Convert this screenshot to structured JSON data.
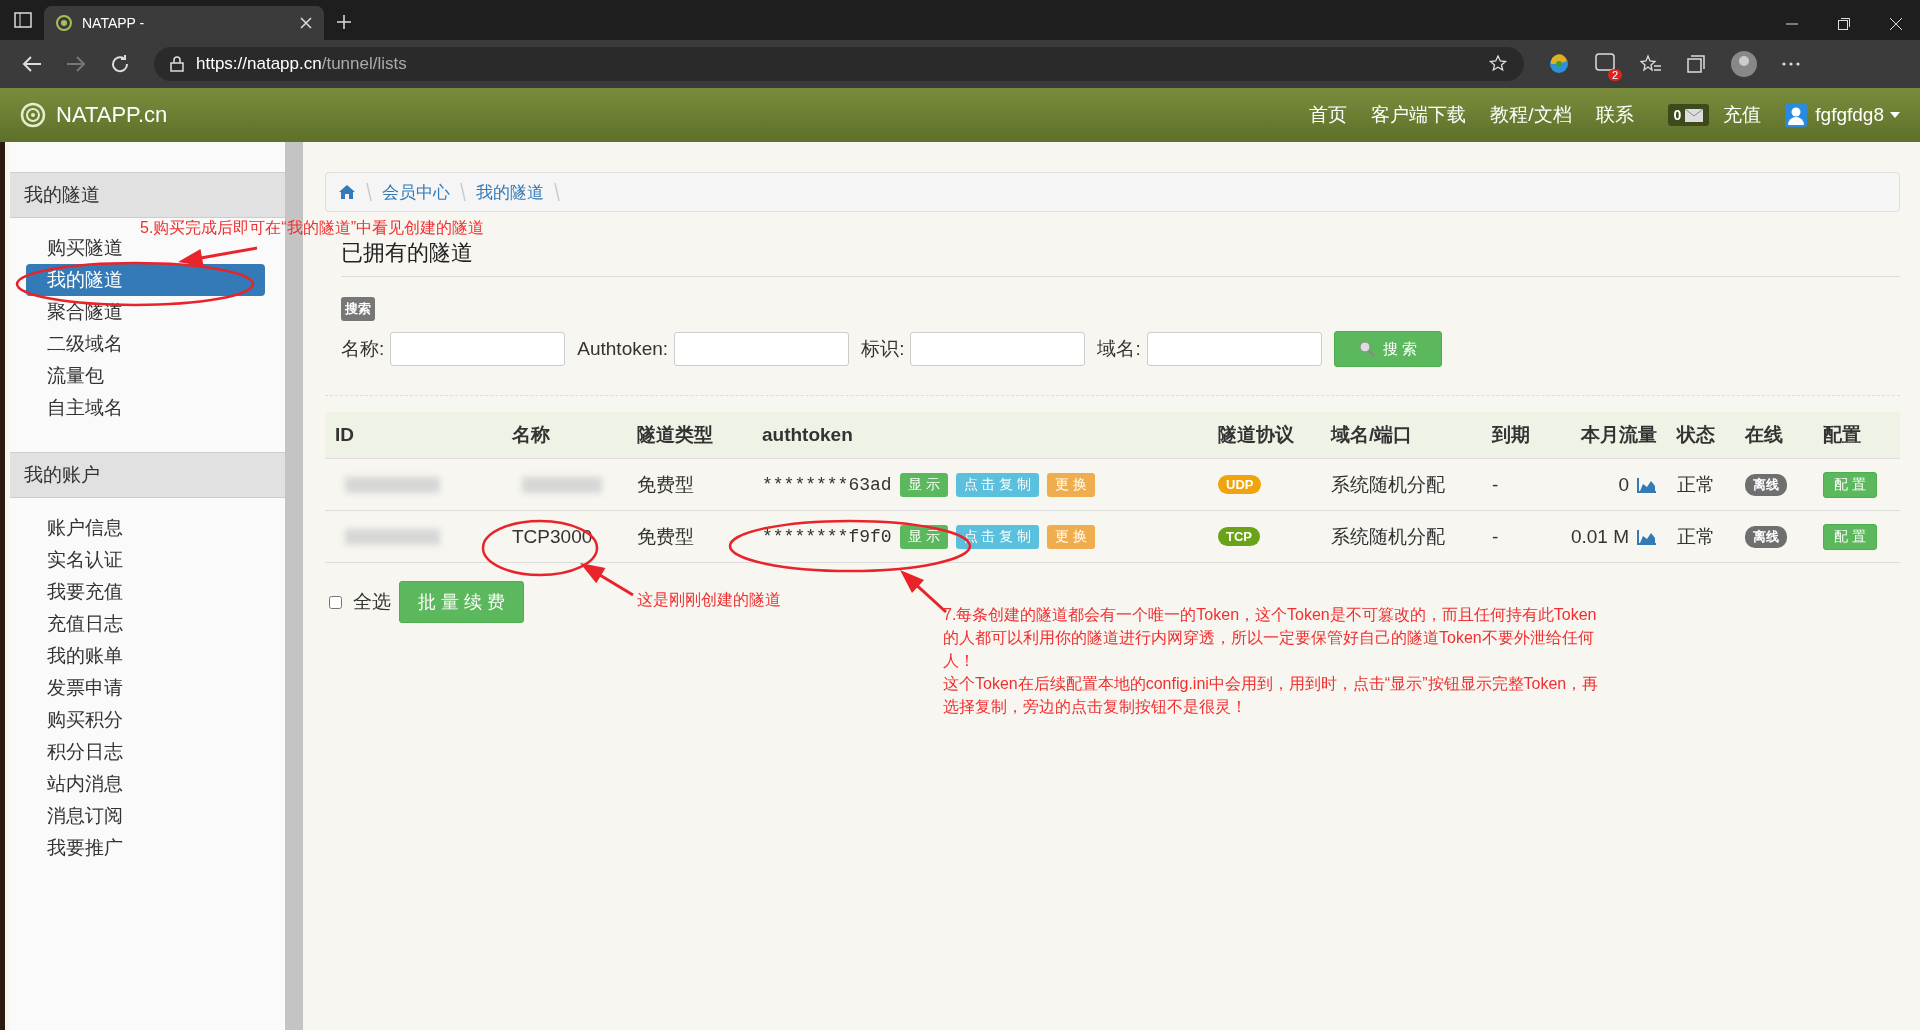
{
  "browser": {
    "tab_title": "NATAPP -",
    "url_host": "https://natapp.cn",
    "url_path": "/tunnel/lists",
    "extension_badge": "2"
  },
  "navbar": {
    "logo": "NATAPP.cn",
    "links": [
      "首页",
      "客户端下载",
      "教程/文档",
      "联系"
    ],
    "mail_count": "0",
    "recharge": "充值",
    "user": "fgfgfdg8"
  },
  "sidebar": [
    {
      "title": "我的隧道",
      "items": [
        {
          "label": "购买隧道",
          "selected": false
        },
        {
          "label": "我的隧道",
          "selected": true
        },
        {
          "label": "聚合隧道",
          "selected": false
        },
        {
          "label": "二级域名",
          "selected": false
        },
        {
          "label": "流量包",
          "selected": false
        },
        {
          "label": "自主域名",
          "selected": false
        }
      ]
    },
    {
      "title": "我的账户",
      "items": [
        {
          "label": "账户信息",
          "selected": false
        },
        {
          "label": "实名认证",
          "selected": false
        },
        {
          "label": "我要充值",
          "selected": false
        },
        {
          "label": "充值日志",
          "selected": false
        },
        {
          "label": "我的账单",
          "selected": false
        },
        {
          "label": "发票申请",
          "selected": false
        },
        {
          "label": "购买积分",
          "selected": false
        },
        {
          "label": "积分日志",
          "selected": false
        },
        {
          "label": "站内消息",
          "selected": false
        },
        {
          "label": "消息订阅",
          "selected": false
        },
        {
          "label": "我要推广",
          "selected": false
        }
      ]
    }
  ],
  "breadcrumb": [
    "会员中心",
    "我的隧道"
  ],
  "page_title": "已拥有的隧道",
  "search": {
    "tag": "搜索",
    "fields": [
      "名称:",
      "Authtoken:",
      "标识:",
      "域名:"
    ],
    "button": "搜 索"
  },
  "table": {
    "columns": [
      "ID",
      "名称",
      "隧道类型",
      "authtoken",
      "隧道协议",
      "域名/端口",
      "到期",
      "本月流量",
      "状态",
      "在线",
      "配置"
    ],
    "rows": [
      {
        "type": "免费型",
        "token": "********63ad",
        "token_buttons": [
          "显 示",
          "点 击 复 制",
          "更 换"
        ],
        "protocol": "UDP",
        "color": "#f0a30a",
        "domain": "系统随机分配",
        "expiry": "-",
        "traffic": "0",
        "status": "正常",
        "online": "离线",
        "config": "配 置"
      },
      {
        "name": "TCP3000",
        "type": "免费型",
        "token": "********f9f0",
        "token_buttons": [
          "显 示",
          "点 击 复 制",
          "更 换"
        ],
        "protocol": "TCP",
        "color": "#6aa318",
        "domain": "系统随机分配",
        "expiry": "-",
        "traffic": "0.01 M",
        "status": "正常",
        "online": "离线",
        "config": "配 置"
      }
    ]
  },
  "select_all": {
    "label": "全选",
    "checked": false
  },
  "batch_button": "批 量 续 费",
  "annotations": [
    "5.购买完成后即可在“我的隧道”中看见创建的隧道",
    "这是刚刚创建的隧道",
    "7.每条创建的隧道都会有一个唯一的Token，这个Token是不可篡改的，而且任何持有此Token的人都可以利用你的隧道进行内网穿透，所以一定要保管好自己的隧道Token不要外泄给任何人！",
    "这个Token在后续配置本地的config.ini中会用到，用到时，点击“显示”按钮显示完整Token，再选择复制，旁边的点击复制按钮不是很灵！"
  ]
}
